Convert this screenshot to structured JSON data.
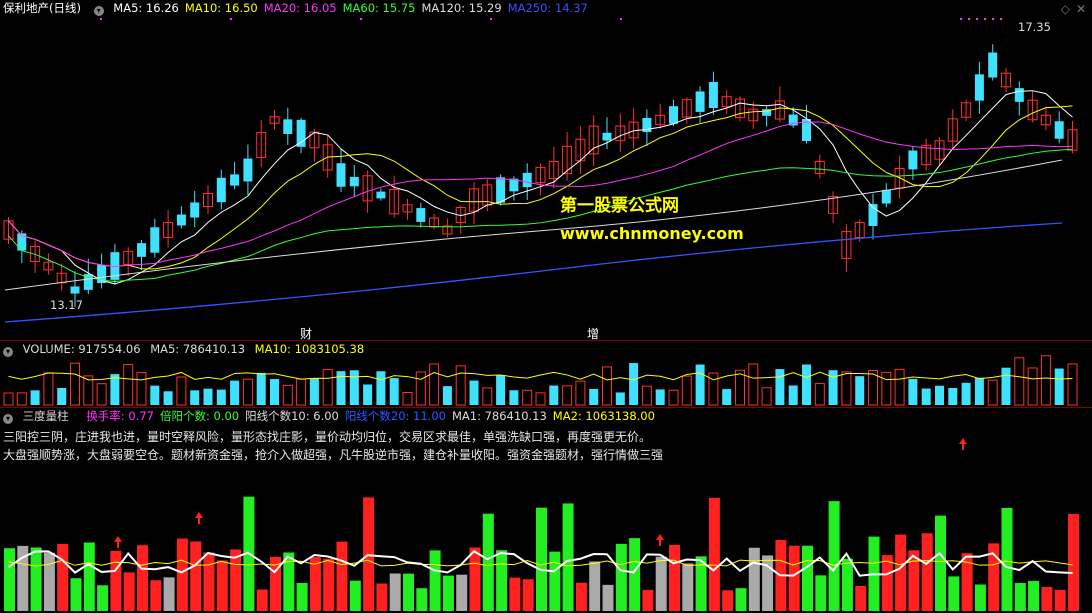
{
  "price": {
    "title": "保利地产(日线)",
    "mas": [
      {
        "label": "MA5: 16.26",
        "color": "#ffffff"
      },
      {
        "label": "MA10: 16.50",
        "color": "#ffff00"
      },
      {
        "label": "MA20: 16.05",
        "color": "#ff33ff"
      },
      {
        "label": "MA60: 15.75",
        "color": "#33ff33"
      },
      {
        "label": "MA120: 15.29",
        "color": "#dddddd"
      },
      {
        "label": "MA250: 14.37",
        "color": "#3355ff"
      }
    ],
    "high_label": "17.35",
    "low_label": "13.17",
    "markers": [
      "财",
      "增"
    ]
  },
  "watermark": {
    "line1": "第一股票公式网",
    "line2": "www.chnmoney.com"
  },
  "volume": {
    "title": "VOLUME: 917554.06",
    "ma5": "MA5: 786410.13",
    "ma10": "MA10: 1083105.38"
  },
  "indicator": {
    "title": "三度量柱",
    "items": [
      {
        "label": "换手率: 0.77",
        "color": "#ff33ff"
      },
      {
        "label": "倍阳个数: 0.00",
        "color": "#33ff33"
      },
      {
        "label": "阳线个数10: 6.00",
        "color": "#dddddd"
      },
      {
        "label": "阳线个数20: 11.00",
        "color": "#3355ff"
      },
      {
        "label": "MA1: 786410.13",
        "color": "#dddddd"
      },
      {
        "label": "MA2: 1063138.00",
        "color": "#ffff00"
      }
    ],
    "note1": "三阳控三阴，庄进我也进，量时空释风险，量形态找庄影，量价动均归位，交易区求最佳，单强洗缺口强，再度强更无价。",
    "note2": "大盘强顺势涨，大盘弱要空仓。题材新资金强，抢介入做超强，凡牛股逆市强，建仓补量收阳。强资金强题材，强行情做三强"
  },
  "chart_data": {
    "type": "candlestick",
    "series_count": 81,
    "price_range": [
      13.17,
      17.35
    ],
    "ma_labels": [
      "MA5",
      "MA10",
      "MA20",
      "MA60",
      "MA120",
      "MA250"
    ]
  }
}
